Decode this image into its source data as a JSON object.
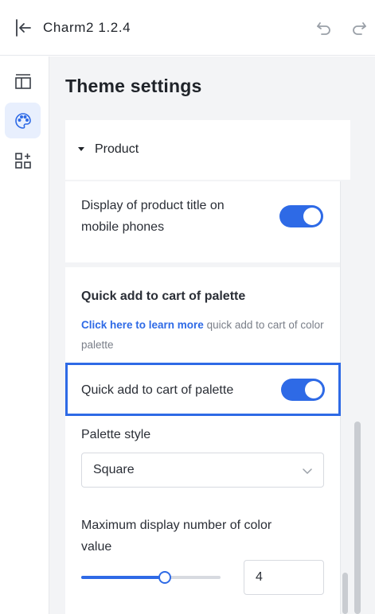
{
  "app": {
    "title": "Charm2 1.2.4"
  },
  "rail": {
    "items": [
      {
        "name": "layout-icon",
        "active": false
      },
      {
        "name": "palette-icon",
        "active": true
      },
      {
        "name": "add-widget-icon",
        "active": false
      }
    ]
  },
  "main": {
    "page_title": "Theme settings",
    "section": {
      "label": "Product",
      "expanded": true
    },
    "mobile_title": {
      "label": "Display of product title on mobile phones",
      "line1": "Display of product title on",
      "line2": "mobile phones",
      "enabled": true
    },
    "quick_add": {
      "heading": "Quick add to cart of palette",
      "help_link": "Click here to learn more",
      "help_rest": " quick add to cart of color palette",
      "toggle_label": "Quick add to cart of palette",
      "enabled": true
    },
    "palette_style": {
      "label": "Palette style",
      "value": "Square"
    },
    "max_colors": {
      "label_line1": "Maximum display number of color",
      "label_line2": "value",
      "value": "4",
      "slider_fraction": 0.6
    }
  },
  "colors": {
    "accent": "#2e6ae6",
    "background": "#f3f4f6"
  }
}
